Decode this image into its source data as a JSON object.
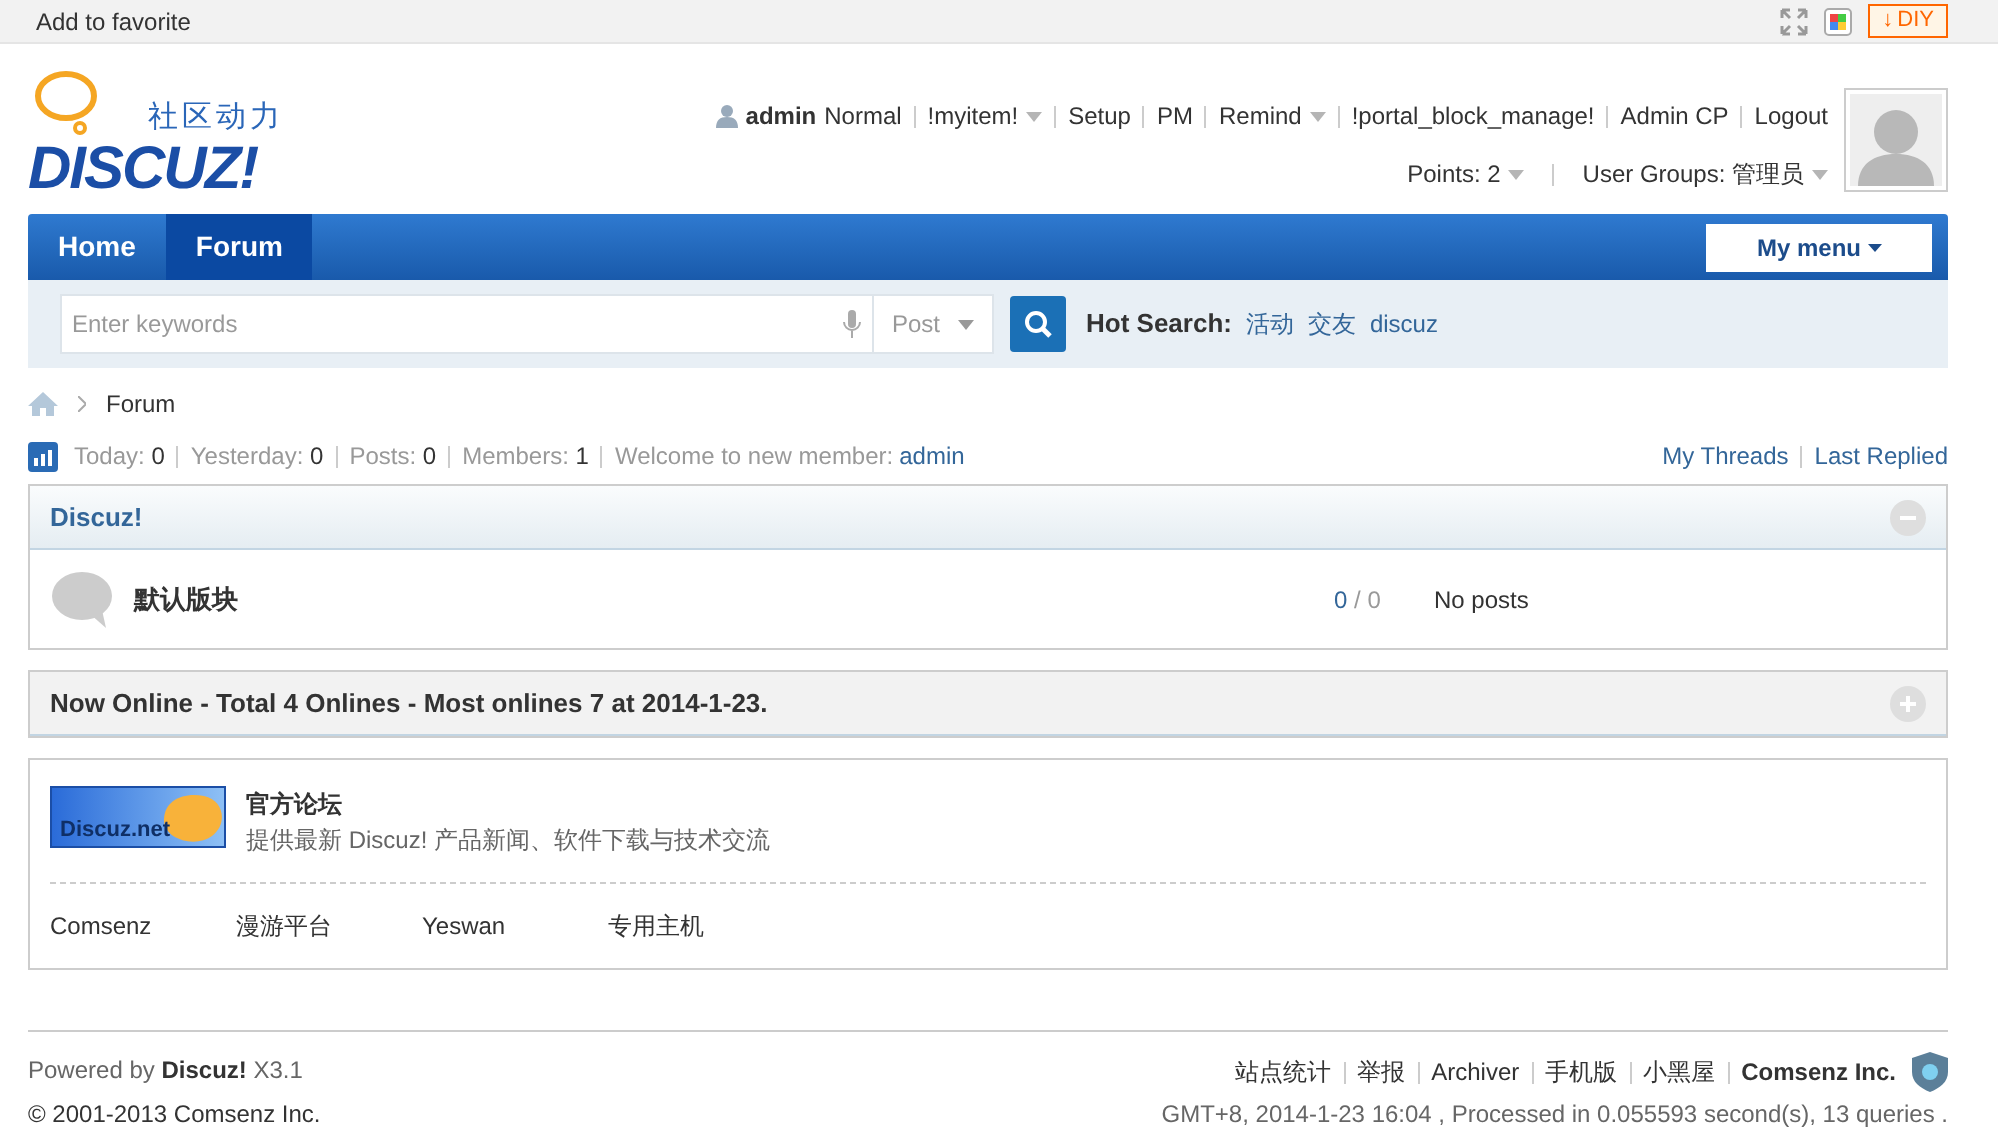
{
  "topbar": {
    "favorite": "Add to favorite",
    "diy_arrow": "↓",
    "diy": "DIY"
  },
  "logo": {
    "tagline": "社区动力",
    "name": "DISCUZ!"
  },
  "user": {
    "name": "admin",
    "level": "Normal",
    "links": [
      {
        "label": "!myitem!",
        "dropdown": true
      },
      {
        "label": "Setup",
        "dropdown": false
      },
      {
        "label": "PM",
        "dropdown": false
      },
      {
        "label": "Remind",
        "dropdown": true
      },
      {
        "label": "!portal_block_manage!",
        "dropdown": false
      },
      {
        "label": "Admin CP",
        "dropdown": false
      },
      {
        "label": "Logout",
        "dropdown": false
      }
    ],
    "points": "Points: 2",
    "groups": "User Groups: 管理员"
  },
  "nav": {
    "tabs": [
      {
        "label": "Home",
        "selected": false
      },
      {
        "label": "Forum",
        "selected": true
      }
    ],
    "my_menu": "My menu"
  },
  "search": {
    "placeholder": "Enter keywords",
    "type": "Post",
    "hot_label": "Hot Search:",
    "hot": [
      "活动",
      "交友",
      "discuz"
    ]
  },
  "breadcrumb": "Forum",
  "stats": {
    "items": [
      {
        "label": "Today:",
        "value": "0"
      },
      {
        "label": "Yesterday:",
        "value": "0"
      },
      {
        "label": "Posts:",
        "value": "0"
      },
      {
        "label": "Members:",
        "value": "1"
      }
    ],
    "welcome": "Welcome to new member:",
    "new_member": "admin",
    "links": [
      "My Threads",
      "Last Replied"
    ]
  },
  "category": {
    "title": "Discuz!",
    "expanded": true,
    "forums": [
      {
        "name": "默认版块",
        "threads": "0",
        "divider": "/",
        "posts": "0",
        "last": "No posts"
      }
    ]
  },
  "online": {
    "title": "Now Online - Total 4 Onlines - Most onlines 7 at 2014-1-23.",
    "expanded": false
  },
  "links_box": {
    "featured": {
      "logo": "Discuz.net",
      "title": "官方论坛",
      "description": "提供最新 Discuz! 产品新闻、软件下载与技术交流"
    },
    "links": [
      "Comsenz",
      "漫游平台",
      "Yeswan",
      "专用主机"
    ]
  },
  "footer": {
    "powered": "Powered by",
    "product": "Discuz!",
    "version": "X3.1",
    "copyright": "© 2001-2013 Comsenz Inc.",
    "links": [
      "站点统计",
      "举报",
      "Archiver",
      "手机版",
      "小黑屋"
    ],
    "company": "Comsenz Inc.",
    "status": "GMT+8, 2014-1-23 16:04 , Processed in 0.055593 second(s), 13 queries ."
  }
}
